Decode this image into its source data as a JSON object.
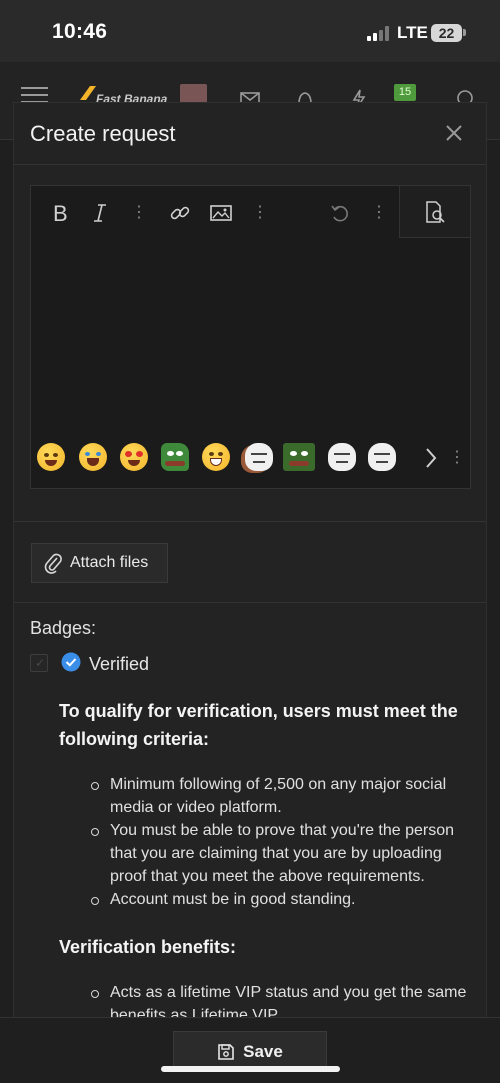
{
  "status_bar": {
    "time": "10:46",
    "network": "LTE",
    "battery": "22"
  },
  "site_header": {
    "logo_text": "Fast Banana",
    "notification_count": "15",
    "icons": [
      "menu-icon",
      "mail-icon",
      "bell-icon",
      "bolt-icon",
      "chat-icon",
      "search-icon"
    ]
  },
  "modal": {
    "title": "Create request",
    "toolbar": {
      "buttons": [
        "bold-icon",
        "italic-icon",
        "more-icon",
        "link-icon",
        "image-icon",
        "more-icon",
        "undo-icon",
        "more-icon",
        "preview-icon"
      ]
    },
    "attach_label": "Attach files",
    "badges_label": "Badges:",
    "verified_label": "Verified",
    "criteria_heading": "To qualify for verification, users must meet the following criteria:",
    "criteria": [
      "Minimum following of 2,500 on any major social media or video platform.",
      "You must be able to prove that you're the person that you are claiming that you are by uploading proof that you meet the above requirements.",
      "Account must be in good standing."
    ],
    "benefits_heading": "Verification benefits:",
    "benefits": [
      "Acts as a lifetime VIP status and you get the same benefits as Lifetime VIP."
    ],
    "save_label": "Save"
  },
  "colors": {
    "accent_blue": "#3b8ee8",
    "badge_green": "#4f9a3d"
  }
}
